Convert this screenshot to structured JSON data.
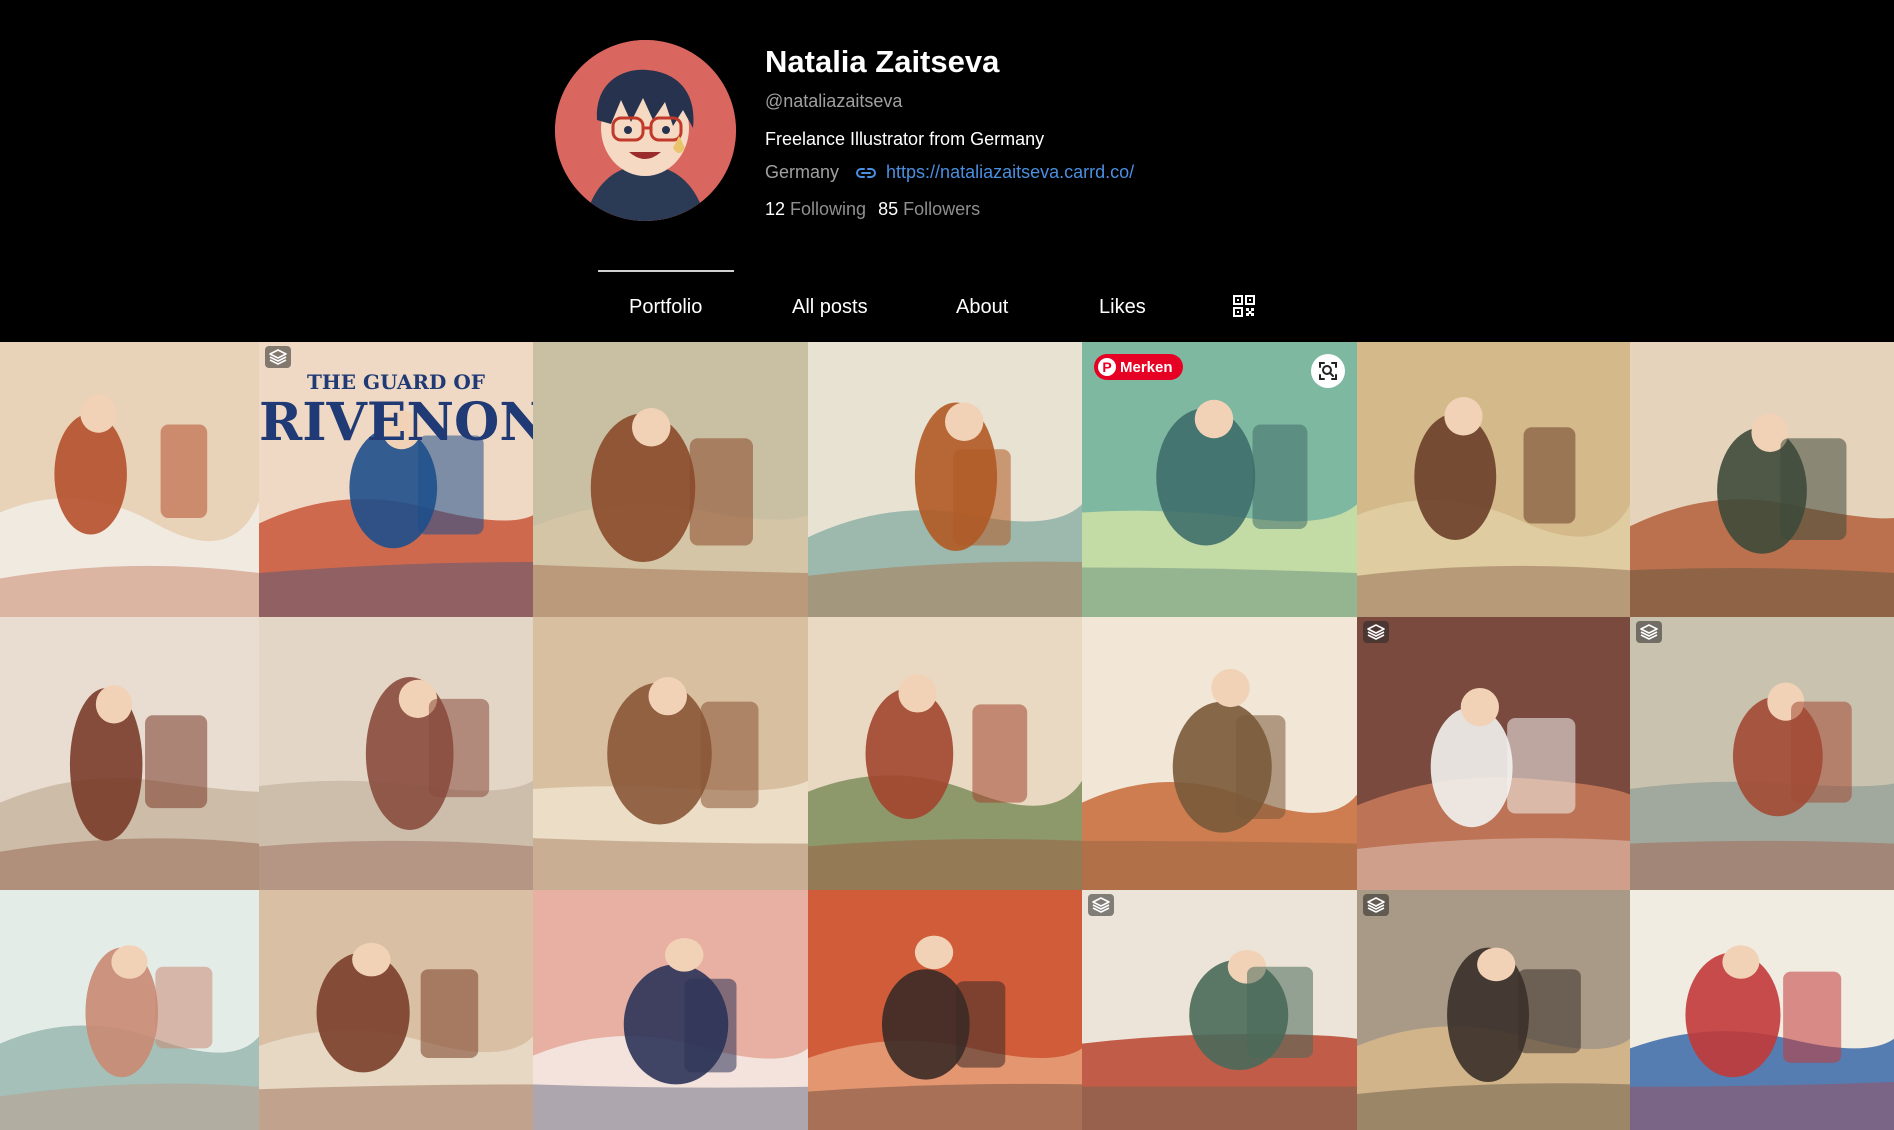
{
  "profile": {
    "display_name": "Natalia Zaitseva",
    "handle": "@nataliazaitseva",
    "bio": "Freelance Illustrator from Germany",
    "country": "Germany",
    "website": "https://nataliazaitseva.carrd.co/",
    "following_count": "12",
    "following_label": "Following",
    "followers_count": "85",
    "followers_label": "Followers"
  },
  "tabs": [
    {
      "label": "Portfolio",
      "active": true
    },
    {
      "label": "All posts",
      "active": false
    },
    {
      "label": "About",
      "active": false
    },
    {
      "label": "Likes",
      "active": false
    }
  ],
  "colors": {
    "background": "#000000",
    "link": "#4a8fe0",
    "pinterest": "#e60023"
  },
  "overlays": {
    "save_button_label": "Merken",
    "poster_title_line1": "THE GUARD OF",
    "poster_title_line2": "RIVENON"
  },
  "gallery": [
    {
      "row": 0,
      "col": 0,
      "icon": "",
      "palette": [
        "#e8d2b8",
        "#b5502e",
        "#f2efe8"
      ]
    },
    {
      "row": 0,
      "col": 1,
      "icon": "multi-image-icon",
      "palette": [
        "#f0d9c4",
        "#1e4f8c",
        "#c8553a"
      ]
    },
    {
      "row": 0,
      "col": 2,
      "icon": "",
      "palette": [
        "#c9bfa3",
        "#8a4a2a",
        "#d6c6a8"
      ]
    },
    {
      "row": 0,
      "col": 3,
      "icon": "",
      "palette": [
        "#e8e2d2",
        "#b05a24",
        "#8fb1a8"
      ]
    },
    {
      "row": 0,
      "col": 4,
      "icon": "pinterest-save",
      "palette": [
        "#7fb8a0",
        "#3f6e6a",
        "#cfe0a6"
      ]
    },
    {
      "row": 0,
      "col": 5,
      "icon": "",
      "palette": [
        "#d4b98a",
        "#6b3f2a",
        "#e2cfa4"
      ]
    },
    {
      "row": 0,
      "col": 6,
      "icon": "",
      "palette": [
        "#e6d3bc",
        "#3e4a3a",
        "#b35f3a"
      ]
    },
    {
      "row": 1,
      "col": 0,
      "icon": "",
      "palette": [
        "#e8ddd0",
        "#7a3b2a",
        "#c8b6a0"
      ]
    },
    {
      "row": 1,
      "col": 1,
      "icon": "",
      "palette": [
        "#e3d6c6",
        "#8a4c3e",
        "#c9b8a6"
      ]
    },
    {
      "row": 1,
      "col": 2,
      "icon": "",
      "palette": [
        "#d8bfa0",
        "#8a5636",
        "#efe2cd"
      ]
    },
    {
      "row": 1,
      "col": 3,
      "icon": "",
      "palette": [
        "#e9d9c2",
        "#a2452f",
        "#7c8c5c"
      ]
    },
    {
      "row": 1,
      "col": 4,
      "icon": "",
      "palette": [
        "#f2e6d6",
        "#7a5a3a",
        "#c86a3a"
      ]
    },
    {
      "row": 1,
      "col": 5,
      "icon": "multi-image-icon",
      "palette": [
        "#7a4a3f",
        "#f2f2ee",
        "#c97a5a"
      ]
    },
    {
      "row": 1,
      "col": 6,
      "icon": "multi-image-icon",
      "palette": [
        "#c9c2ae",
        "#a24a34",
        "#9aa39a"
      ]
    },
    {
      "row": 2,
      "col": 0,
      "icon": "",
      "palette": [
        "#e4ece8",
        "#c98a72",
        "#9ab8b0"
      ]
    },
    {
      "row": 2,
      "col": 1,
      "icon": "",
      "palette": [
        "#d9c0a4",
        "#7a3f2a",
        "#e8dcc8"
      ]
    },
    {
      "row": 2,
      "col": 2,
      "icon": "",
      "palette": [
        "#e8b0a2",
        "#2c3358",
        "#f4ece6"
      ]
    },
    {
      "row": 2,
      "col": 3,
      "icon": "",
      "palette": [
        "#d05c3a",
        "#3a2a26",
        "#e6a07a"
      ]
    },
    {
      "row": 2,
      "col": 4,
      "icon": "multi-image-icon",
      "palette": [
        "#ece4d8",
        "#4a6a5a",
        "#b8442e"
      ]
    },
    {
      "row": 2,
      "col": 5,
      "icon": "multi-image-icon",
      "palette": [
        "#a89a86",
        "#3a302a",
        "#d8b88a"
      ]
    },
    {
      "row": 2,
      "col": 6,
      "icon": "",
      "palette": [
        "#f0ece2",
        "#c23a3a",
        "#3a6aa8"
      ]
    }
  ]
}
